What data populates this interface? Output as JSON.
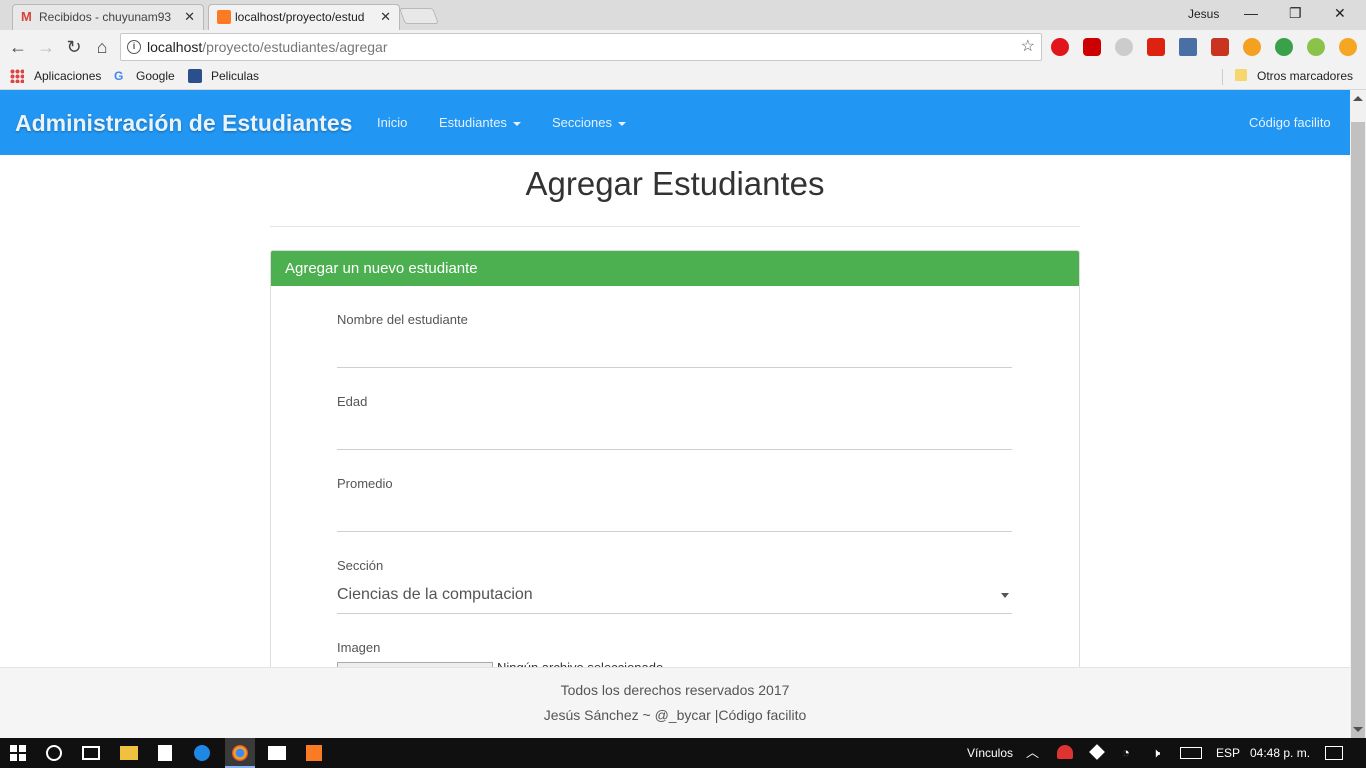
{
  "browser": {
    "tabs": [
      {
        "title": "Recibidos - chuyunam93",
        "active": false
      },
      {
        "title": "localhost/proyecto/estud",
        "active": true
      }
    ],
    "user": "Jesus",
    "address": {
      "host": "localhost",
      "path": "/proyecto/estudiantes/agregar"
    },
    "bookmarks": [
      "Aplicaciones",
      "Google",
      "Peliculas"
    ],
    "other_bookmarks": "Otros marcadores"
  },
  "navbar": {
    "brand": "Administración de Estudiantes",
    "links": [
      "Inicio",
      "Estudiantes",
      "Secciones"
    ],
    "right_link": "Código facilito",
    "color": "#2196f3"
  },
  "page": {
    "title": "Agregar Estudiantes",
    "panel_heading": "Agregar un nuevo estudiante",
    "panel_color": "#4caf50",
    "fields": {
      "nombre": "Nombre del estudiante",
      "edad": "Edad",
      "promedio": "Promedio",
      "seccion": "Sección",
      "seccion_value": "Ciencias de la computacion",
      "imagen": "Imagen",
      "file_status": "Ningún archivo seleccionado"
    }
  },
  "footer": {
    "line1": "Todos los derechos reservados 2017",
    "line2": "Jesús Sánchez ~ @_bycar |Código facilito"
  },
  "taskbar": {
    "links_label": "Vínculos",
    "lang": "ESP",
    "time": "04:48 p. m."
  }
}
